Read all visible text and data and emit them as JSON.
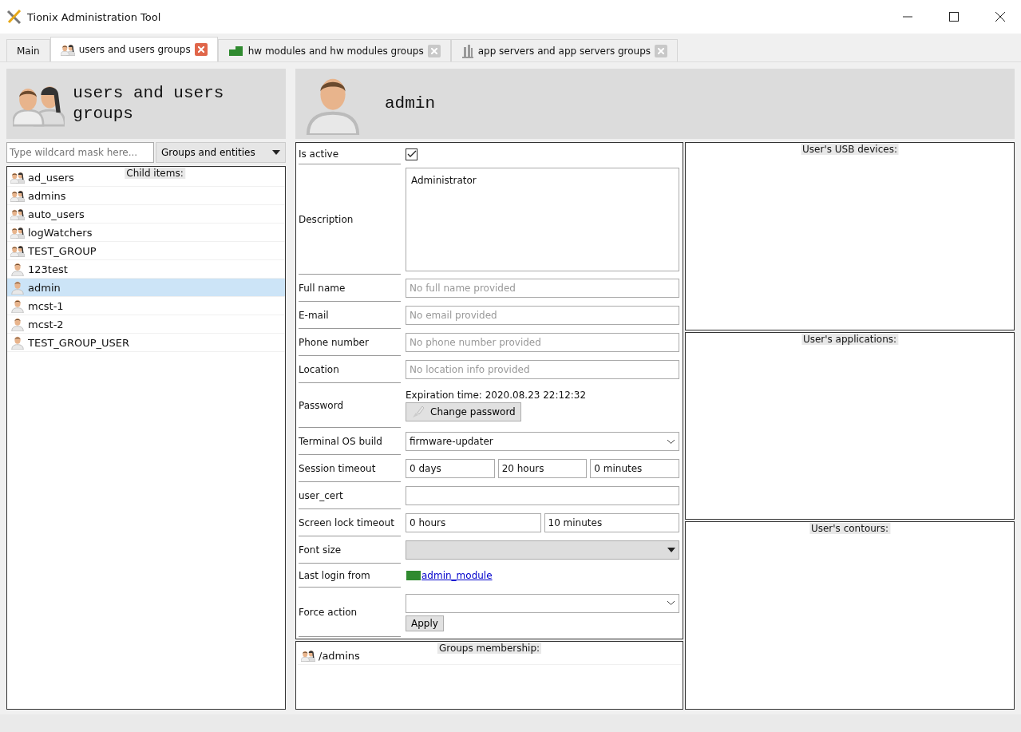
{
  "window": {
    "title": "Tionix Administration Tool"
  },
  "tabs": [
    {
      "label": "Main",
      "kind": "plain",
      "selected": false
    },
    {
      "label": "users and users groups",
      "kind": "users",
      "selected": true
    },
    {
      "label": "hw modules and hw modules groups",
      "kind": "modules",
      "selected": false
    },
    {
      "label": "app servers and app servers groups",
      "kind": "servers",
      "selected": false
    }
  ],
  "sidebar": {
    "title": "users and users groups",
    "filter": {
      "placeholder": "Type wildcard mask here..."
    },
    "mode": "Groups and entities",
    "list_caption": "Child items:",
    "items": [
      {
        "label": "ad_users",
        "kind": "group",
        "selected": false
      },
      {
        "label": "admins",
        "kind": "group",
        "selected": false
      },
      {
        "label": "auto_users",
        "kind": "group",
        "selected": false
      },
      {
        "label": "logWatchers",
        "kind": "group",
        "selected": false
      },
      {
        "label": "TEST_GROUP",
        "kind": "group",
        "selected": false
      },
      {
        "label": "123test",
        "kind": "user",
        "selected": false
      },
      {
        "label": "admin",
        "kind": "user",
        "selected": true
      },
      {
        "label": "mcst-1",
        "kind": "user",
        "selected": false
      },
      {
        "label": "mcst-2",
        "kind": "user",
        "selected": false
      },
      {
        "label": "TEST_GROUP_USER",
        "kind": "user",
        "selected": false
      }
    ]
  },
  "detail": {
    "title": "admin",
    "fields": [
      {
        "label": "Is active",
        "kind": "checkbox",
        "checked": true
      },
      {
        "label": "Description",
        "kind": "textarea",
        "value": "Administrator"
      },
      {
        "label": "Full name",
        "kind": "text",
        "placeholder": "No full name provided"
      },
      {
        "label": "E-mail",
        "kind": "text",
        "placeholder": "No email provided"
      },
      {
        "label": "Phone number",
        "kind": "text",
        "placeholder": "No phone number provided"
      },
      {
        "label": "Location",
        "kind": "text",
        "placeholder": "No location info provided"
      },
      {
        "label": "Password",
        "kind": "password",
        "note": "Expiration time: 2020.08.23 22:12:32",
        "button": "Change password"
      },
      {
        "label": "Terminal OS build",
        "kind": "select",
        "value": "firmware-updater",
        "disabled": false
      },
      {
        "label": "Session timeout",
        "kind": "multi",
        "values": [
          "0 days",
          "20 hours",
          "0 minutes"
        ]
      },
      {
        "label": "user_cert",
        "kind": "text"
      },
      {
        "label": "Screen lock timeout",
        "kind": "multi",
        "values": [
          "0 hours",
          "10 minutes"
        ]
      },
      {
        "label": "Font size",
        "kind": "select",
        "disabled": true
      },
      {
        "label": "Last login from",
        "kind": "link",
        "value": "admin_module"
      },
      {
        "label": "Force action",
        "kind": "action",
        "button": "Apply"
      }
    ],
    "groups": {
      "caption": "Groups membership:",
      "items": [
        "/admins"
      ]
    }
  },
  "panels": [
    {
      "caption": "User's USB devices:"
    },
    {
      "caption": "User's applications:"
    },
    {
      "caption": "User's contours:"
    }
  ]
}
